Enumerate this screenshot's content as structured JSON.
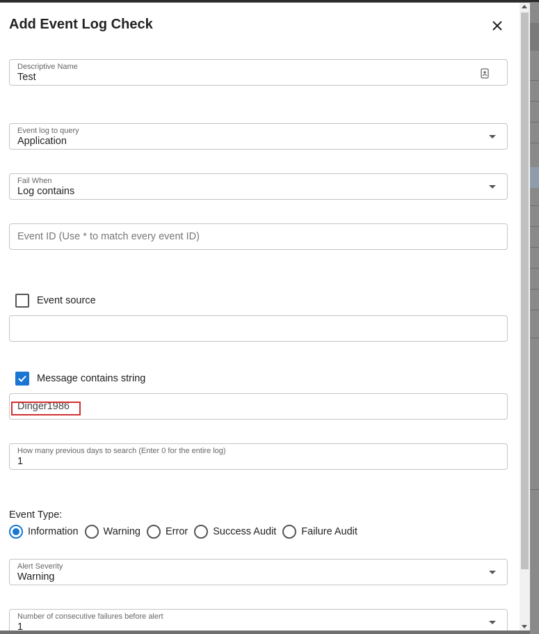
{
  "dialog": {
    "title": "Add Event Log Check"
  },
  "fields": {
    "descriptive_name": {
      "label": "Descriptive Name",
      "value": "Test"
    },
    "event_log": {
      "label": "Event log to query",
      "value": "Application"
    },
    "fail_when": {
      "label": "Fail When",
      "value": "Log contains"
    },
    "event_id": {
      "placeholder": "Event ID (Use * to match every event ID)"
    },
    "event_source": {
      "label": "Event source",
      "checked": false,
      "value": ""
    },
    "message": {
      "label": "Message contains string",
      "checked": true,
      "value": "Dinger1986"
    },
    "days": {
      "label": "How many previous days to search (Enter 0 for the entire log)",
      "value": "1"
    },
    "severity": {
      "label": "Alert Severity",
      "value": "Warning"
    },
    "failures": {
      "label": "Number of consecutive failures before alert",
      "value": "1"
    }
  },
  "event_type": {
    "label": "Event Type:",
    "options": [
      "Information",
      "Warning",
      "Error",
      "Success Audit",
      "Failure Audit"
    ],
    "selected": "Information"
  },
  "colors": {
    "accent": "#1976d2",
    "highlight_box": "#d32f2f"
  },
  "icons": {
    "close": "close-icon",
    "contact_card": "contact-card-icon",
    "dropdown": "chevron-down-icon"
  }
}
